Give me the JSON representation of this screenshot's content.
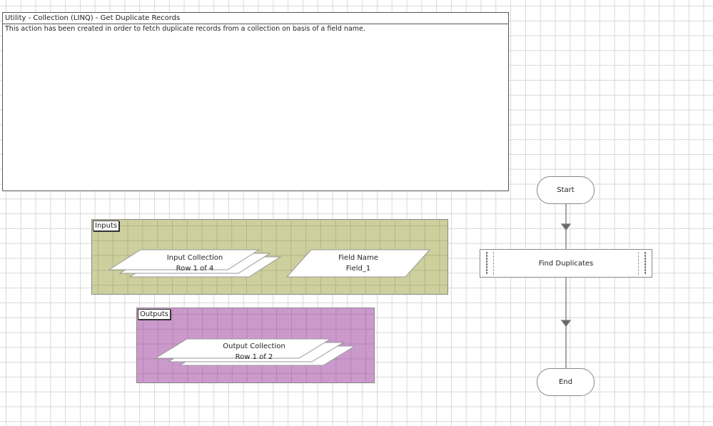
{
  "note": {
    "title": "Utility - Collection (LINQ) - Get Duplicate Records",
    "description": "This action has been created in order to fetch duplicate records from a collection on basis of a field name."
  },
  "inputs": {
    "label": "Inputs",
    "color": "#cdcf9d",
    "items": [
      {
        "name": "Input Collection",
        "value": "Row 1 of 4",
        "type": "collection"
      },
      {
        "name": "Field Name",
        "value": "Field_1",
        "type": "data"
      }
    ]
  },
  "outputs": {
    "label": "Outputs",
    "color": "#cc99cc",
    "items": [
      {
        "name": "Output Collection",
        "value": "Row 1 of 2",
        "type": "collection"
      }
    ]
  },
  "flow": {
    "start": "Start",
    "action": "Find Duplicates",
    "end": "End"
  }
}
